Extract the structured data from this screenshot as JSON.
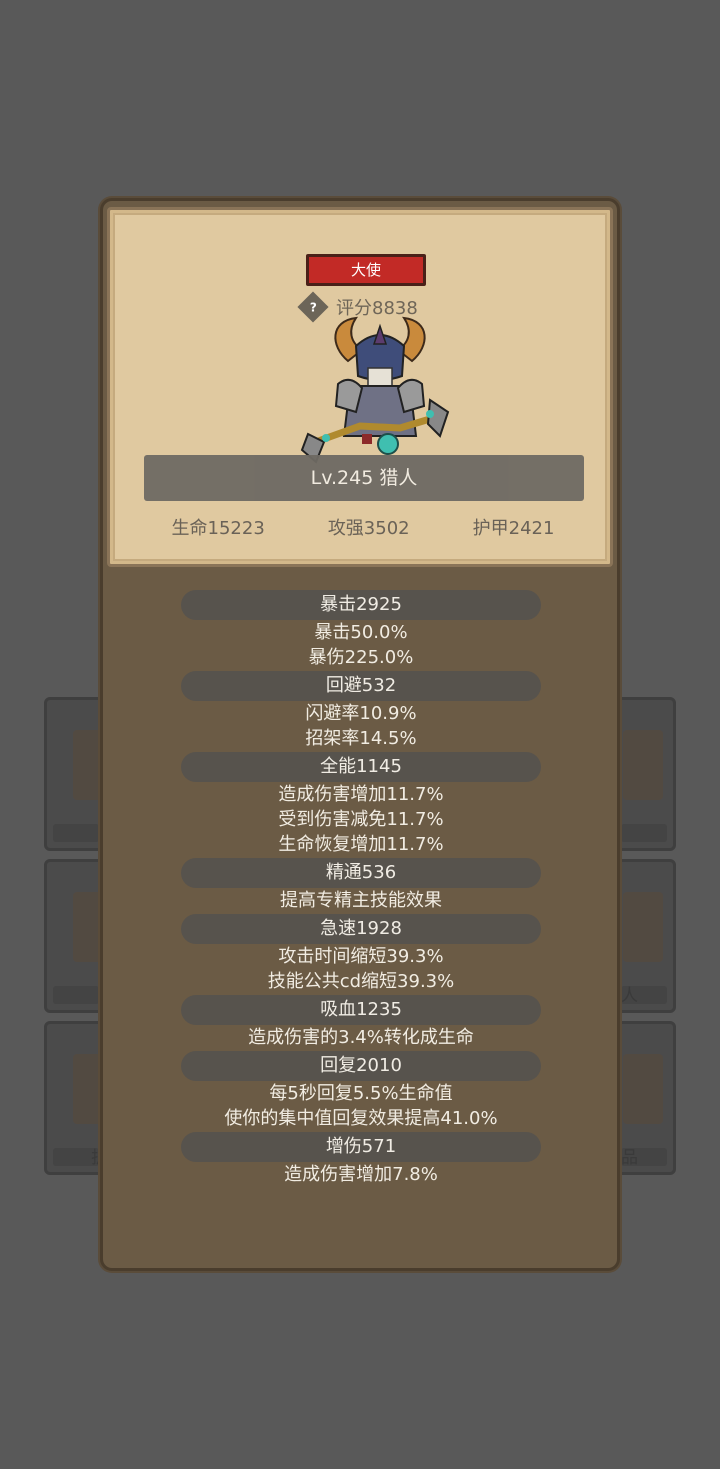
{
  "background_slots": {
    "left_bottom_label": "护",
    "right_middle_label": "人",
    "right_bottom_label": "品"
  },
  "card": {
    "rank_badge": "大使",
    "help_icon": "?",
    "score": "评分8838",
    "level_class": "Lv.245 猎人",
    "base_stats": [
      "生命15223",
      "攻强3502",
      "护甲2421"
    ]
  },
  "stat_groups": [
    {
      "header": "暴击2925",
      "lines": [
        "暴击50.0%",
        "暴伤225.0%"
      ]
    },
    {
      "header": "回避532",
      "lines": [
        "闪避率10.9%",
        "招架率14.5%"
      ]
    },
    {
      "header": "全能1145",
      "lines": [
        "造成伤害增加11.7%",
        "受到伤害减免11.7%",
        "生命恢复增加11.7%"
      ]
    },
    {
      "header": "精通536",
      "lines": [
        "提高专精主技能效果"
      ]
    },
    {
      "header": "急速1928",
      "lines": [
        "攻击时间缩短39.3%",
        "技能公共cd缩短39.3%"
      ]
    },
    {
      "header": "吸血1235",
      "lines": [
        "造成伤害的3.4%转化成生命"
      ]
    },
    {
      "header": "回复2010",
      "lines": [
        "每5秒回复5.5%生命值",
        "使你的集中值回复效果提高41.0%"
      ]
    },
    {
      "header": "增伤571",
      "lines": [
        "造成伤害增加7.8%"
      ]
    }
  ],
  "colors": {
    "backdrop": "#595959",
    "panel": "#6b5b45",
    "card": "#e0c9a0",
    "rank_badge": "#c22a26",
    "header_pill": "#57534d"
  }
}
